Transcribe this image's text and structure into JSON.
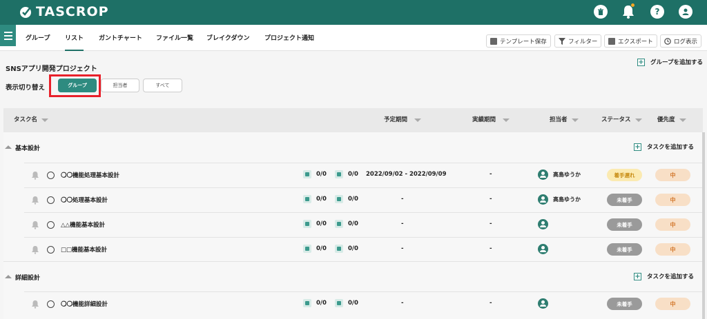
{
  "app": {
    "name": "TASCROP",
    "colors": {
      "primary": "#1e7066",
      "accent": "#2e8b80",
      "highlight": "#e8202a"
    }
  },
  "header": {
    "icons": [
      "trash-icon",
      "bell-icon",
      "help-icon",
      "user-icon"
    ],
    "help_label": "?"
  },
  "tabs": [
    {
      "label": "グループ"
    },
    {
      "label": "リスト",
      "active": true
    },
    {
      "label": "ガントチャート"
    },
    {
      "label": "ファイル一覧"
    },
    {
      "label": "ブレイクダウン"
    },
    {
      "label": "プロジェクト通知"
    }
  ],
  "toolbar": {
    "template_label": "テンプレート保存",
    "filter_label": "フィルター",
    "export_label": "エクスポート",
    "log_label": "ログ表示"
  },
  "project": {
    "title": "SNSアプリ開発プロジェクト",
    "add_group_label": "グループを追加する"
  },
  "view_toggle": {
    "label": "表示切り替え",
    "options": [
      "グループ",
      "担当者",
      "すべて"
    ],
    "selected": "グループ"
  },
  "columns": {
    "task_name": "タスク名",
    "planned": "予定期間",
    "actual": "実績期間",
    "assignee": "担当者",
    "status": "ステータス",
    "priority": "優先度"
  },
  "add_task_label": "タスクを追加する",
  "plus_symbol": "+",
  "groups": [
    {
      "name": "基本設計",
      "tasks": [
        {
          "name": "〇〇機能処理基本設計",
          "sub": "0/0",
          "chk": "0/0",
          "planned": "2022/09/02 - 2022/09/09",
          "actual": "-",
          "assignee": "高島ゆうか",
          "status": "着手遅れ",
          "priority": "中"
        },
        {
          "name": "〇〇処理基本設計",
          "sub": "0/0",
          "chk": "0/0",
          "planned": "-",
          "actual": "-",
          "assignee": "高島ゆうか",
          "status": "未着手",
          "priority": "中"
        },
        {
          "name": "△△機能基本設計",
          "sub": "0/0",
          "chk": "0/0",
          "planned": "-",
          "actual": "-",
          "assignee": "",
          "status": "未着手",
          "priority": "中"
        },
        {
          "name": "□□機能基本設計",
          "sub": "0/0",
          "chk": "0/0",
          "planned": "-",
          "actual": "-",
          "assignee": "",
          "status": "未着手",
          "priority": "中"
        }
      ]
    },
    {
      "name": "詳細設計",
      "tasks": [
        {
          "name": "〇〇機能詳細設計",
          "sub": "0/0",
          "chk": "0/0",
          "planned": "-",
          "actual": "-",
          "assignee": "",
          "status": "未着手",
          "priority": "中"
        }
      ]
    }
  ]
}
